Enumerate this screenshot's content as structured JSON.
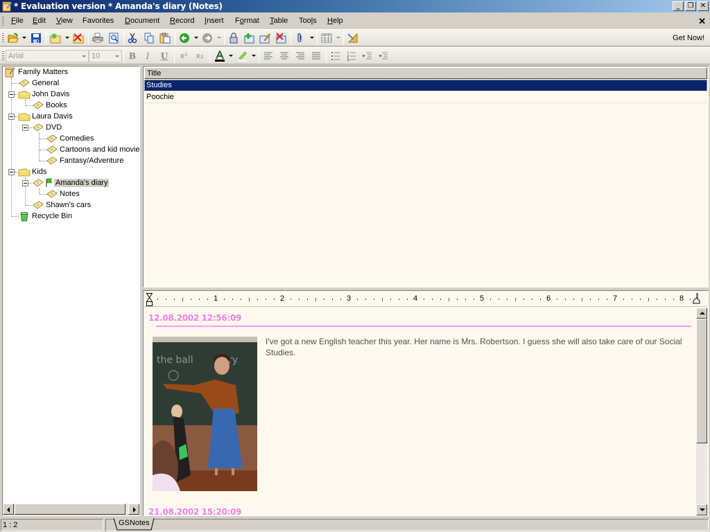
{
  "window": {
    "title": "* Evaluation version * Amanda's diary (Notes)",
    "controls": {
      "minimize": "_",
      "restore": "❐",
      "close": "✕"
    }
  },
  "menubar": {
    "items": [
      {
        "label": "File",
        "accel": "F"
      },
      {
        "label": "Edit",
        "accel": "E"
      },
      {
        "label": "View",
        "accel": "V"
      },
      {
        "label": "Favorites",
        "accel": ""
      },
      {
        "label": "Document",
        "accel": "D"
      },
      {
        "label": "Record",
        "accel": "R"
      },
      {
        "label": "Insert",
        "accel": "I"
      },
      {
        "label": "Format",
        "accel": "o"
      },
      {
        "label": "Table",
        "accel": "T"
      },
      {
        "label": "Tools",
        "accel": "l"
      },
      {
        "label": "Help",
        "accel": "H"
      }
    ],
    "mdi_close": "✕"
  },
  "toolbar": {
    "buttons": [
      {
        "name": "open",
        "icon": "open-folder-icon"
      },
      {
        "name": "save",
        "icon": "save-disk-icon"
      },
      {
        "name": "new-record",
        "icon": "new-record-icon"
      },
      {
        "name": "delete-record",
        "icon": "delete-record-icon"
      },
      {
        "name": "print",
        "icon": "printer-icon"
      },
      {
        "name": "print-preview",
        "icon": "print-preview-icon"
      },
      {
        "name": "cut",
        "icon": "scissors-icon"
      },
      {
        "name": "copy",
        "icon": "copy-icon"
      },
      {
        "name": "paste",
        "icon": "paste-icon"
      },
      {
        "name": "back",
        "icon": "back-arrow-icon"
      },
      {
        "name": "forward",
        "icon": "forward-arrow-icon"
      },
      {
        "name": "lock",
        "icon": "padlock-icon"
      },
      {
        "name": "add-note",
        "icon": "add-note-icon"
      },
      {
        "name": "edit-note",
        "icon": "edit-note-icon"
      },
      {
        "name": "delete-note",
        "icon": "delete-note-icon"
      },
      {
        "name": "attach",
        "icon": "paperclip-icon"
      },
      {
        "name": "table",
        "icon": "table-grid-icon"
      },
      {
        "name": "design",
        "icon": "ruler-triangle-icon"
      }
    ],
    "get_now": "Get Now!"
  },
  "format_toolbar": {
    "font": "Arial",
    "size": "10",
    "bold": "B",
    "italic": "I",
    "underline": "U",
    "superscript": "x²",
    "subscript": "x₂"
  },
  "tree": {
    "items": [
      {
        "label": "Family Matters",
        "icon": "notebook-icon",
        "level": 0
      },
      {
        "label": "General",
        "icon": "note-icon",
        "level": 1
      },
      {
        "label": "John Davis",
        "icon": "folder-icon",
        "level": 1,
        "expanded": true
      },
      {
        "label": "Books",
        "icon": "note-icon",
        "level": 2
      },
      {
        "label": "Laura Davis",
        "icon": "folder-icon",
        "level": 1,
        "expanded": true
      },
      {
        "label": "DVD",
        "icon": "note-icon",
        "level": 2,
        "expanded": true
      },
      {
        "label": "Comedies",
        "icon": "note-icon",
        "level": 3
      },
      {
        "label": "Cartoons and kid movies",
        "icon": "note-icon",
        "level": 3
      },
      {
        "label": "Fantasy/Adventure",
        "icon": "note-icon",
        "level": 3
      },
      {
        "label": "Kids",
        "icon": "folder-icon",
        "level": 1,
        "expanded": true
      },
      {
        "label": "Amanda's diary",
        "icon": "note-icon",
        "level": 2,
        "expanded": true,
        "flag": true,
        "selected": true
      },
      {
        "label": "Notes",
        "icon": "note-icon",
        "level": 3
      },
      {
        "label": "Shawn's cars",
        "icon": "note-icon",
        "level": 2
      },
      {
        "label": "Recycle Bin",
        "icon": "recycle-bin-icon",
        "level": 1
      }
    ]
  },
  "list": {
    "header": "Title",
    "rows": [
      {
        "title": "Studies",
        "selected": true
      },
      {
        "title": "Poochie",
        "selected": false
      }
    ]
  },
  "ruler": {
    "numbers": [
      "1",
      "2",
      "3",
      "4",
      "5",
      "6",
      "7",
      "8"
    ]
  },
  "editor": {
    "entries": [
      {
        "date": "12.08.2002 12:56:09",
        "text": "I've got a new English teacher this year. Her name is Mrs. Robertson. I guess she will also take care of our Social Studies.",
        "image": "teacher-at-blackboard-photo"
      },
      {
        "date": "21.08.2002 15:20:09"
      }
    ],
    "colors": {
      "date": "#f27ef0",
      "background": "#fdf9ee"
    }
  },
  "statusbar": {
    "position": "1 : 2",
    "tab": "GSNotes"
  }
}
